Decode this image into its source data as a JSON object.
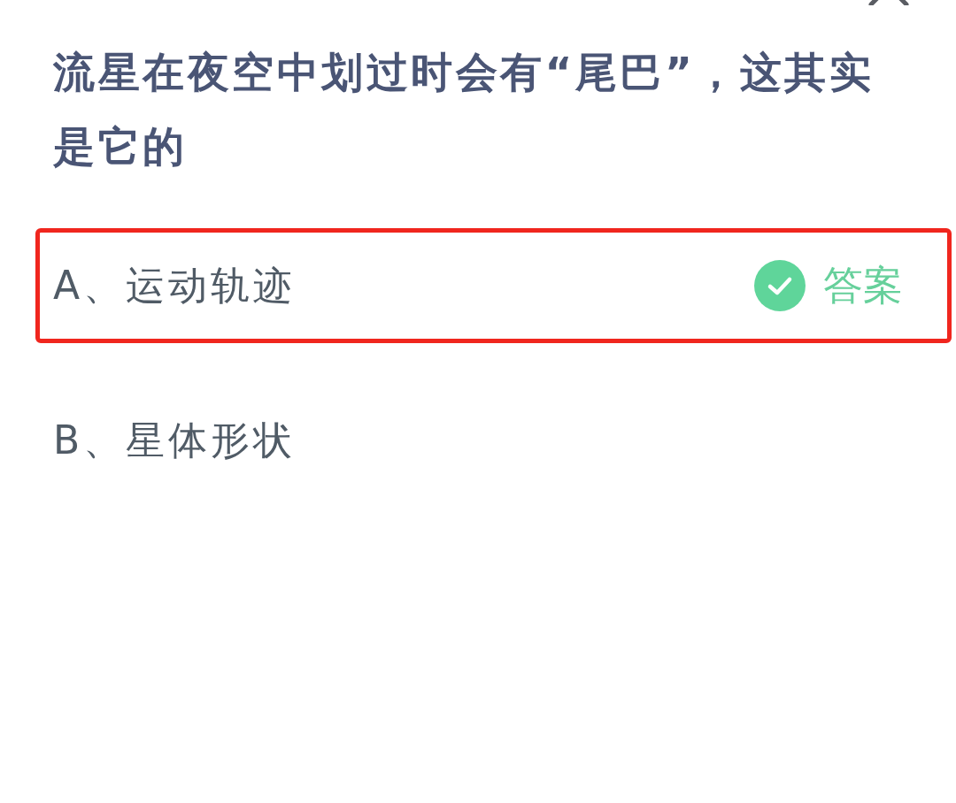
{
  "question": "流星在夜空中划过时会有“尾巴”，这其实是它的",
  "options": [
    {
      "label": "A、运动轨迹",
      "highlighted": true,
      "correct": true,
      "answer_label": "答案"
    },
    {
      "label": "B、星体形状",
      "highlighted": false,
      "correct": false
    }
  ]
}
